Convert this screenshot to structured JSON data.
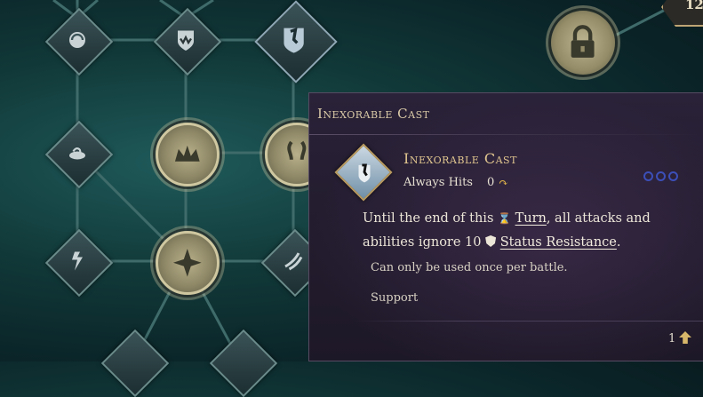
{
  "tree": {
    "nodes": [
      {
        "id": "n1",
        "icon": "orb-spiral-icon"
      },
      {
        "id": "n2",
        "icon": "crown-shield-icon"
      },
      {
        "id": "n3",
        "icon": "inexorable-cast-icon"
      },
      {
        "id": "n4",
        "icon": "vortex-icon"
      },
      {
        "id": "n5",
        "icon": "crown-icon"
      },
      {
        "id": "n6",
        "icon": "rune-icon"
      },
      {
        "id": "n7",
        "icon": "lightning-figure-icon"
      },
      {
        "id": "n8",
        "icon": "star-burst-icon"
      },
      {
        "id": "n9",
        "icon": "claw-icon"
      }
    ],
    "lock_icon": "padlock-icon",
    "level_badge": "12"
  },
  "tooltip": {
    "header": "Inexorable Cast",
    "ability_name": "Inexorable Cast",
    "subtitle": "Always Hits",
    "cost": "0",
    "cost_icon": "refresh-arrow-icon",
    "desc_part1": "Until the end of this",
    "turn_word": "Turn",
    "desc_part2": ", all attacks and abilities ignore 10",
    "status_word": "Status Resistance",
    "desc_end": ".",
    "note": "Can only be used once per battle.",
    "tag": "Support",
    "page": "1",
    "colors": {
      "accent": "#e0c58f",
      "dots": "#3c4fb8",
      "panel": "#241d30"
    }
  }
}
